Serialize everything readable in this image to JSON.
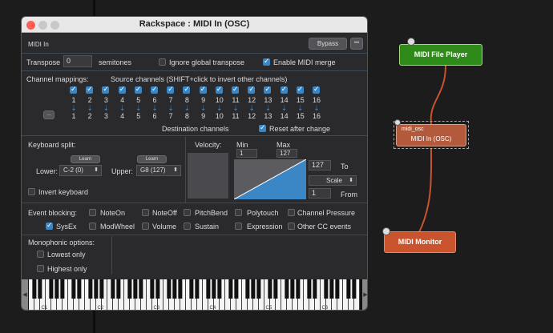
{
  "window": {
    "title": "Rackspace : MIDI In (OSC)",
    "subtitle": "MIDI In",
    "bypass": "Bypass",
    "more": "•••"
  },
  "transpose": {
    "label": "Transpose",
    "value": "0",
    "unit": "semitones",
    "ignore_global": "Ignore global transpose",
    "enable_merge": "Enable MIDI merge"
  },
  "channels": {
    "label": "Channel mappings:",
    "source_label": "Source channels (SHIFT+click to invert other channels)",
    "dest_label": "Destination channels",
    "reset_label": "Reset after change",
    "more_btn": "...",
    "source": [
      "1",
      "2",
      "3",
      "4",
      "5",
      "6",
      "7",
      "8",
      "9",
      "10",
      "11",
      "12",
      "13",
      "14",
      "15",
      "16"
    ],
    "dest": [
      "1",
      "2",
      "3",
      "4",
      "5",
      "6",
      "7",
      "8",
      "9",
      "10",
      "11",
      "12",
      "13",
      "14",
      "15",
      "16"
    ]
  },
  "split": {
    "label": "Keyboard split:",
    "learn1": "Learn",
    "learn2": "Learn",
    "lower_label": "Lower:",
    "lower_value": "C-2 (0)",
    "upper_label": "Upper:",
    "upper_value": "G8 (127)",
    "invert": "Invert keyboard"
  },
  "velocity": {
    "label": "Velocity:",
    "min_label": "Min",
    "max_label": "Max",
    "min": "1",
    "max": "127",
    "to_value": "127",
    "to_label": "To",
    "scale": "Scale",
    "from_value": "1",
    "from_label": "From"
  },
  "event": {
    "label": "Event blocking:",
    "items": [
      "NoteOn",
      "NoteOff",
      "PitchBend",
      "Polytouch",
      "Channel Pressure",
      "SysEx",
      "ModWheel",
      "Volume",
      "Sustain",
      "Expression",
      "Other CC events"
    ]
  },
  "mono": {
    "label": "Monophonic options:",
    "lowest": "Lowest only",
    "highest": "Highest only"
  },
  "keyboard": {
    "octaves": [
      "C1",
      "C2",
      "C3",
      "C4",
      "C5",
      "C6"
    ]
  },
  "nodes": {
    "player": "MIDI File Player",
    "osc_small": "midi_osc",
    "osc": "MIDI In (OSC)",
    "monitor": "MIDI Monitor"
  },
  "colors": {
    "player": "#2e8b1a",
    "osc": "#b35a3c",
    "monitor": "#c8532c",
    "accent": "#3b86c5"
  }
}
